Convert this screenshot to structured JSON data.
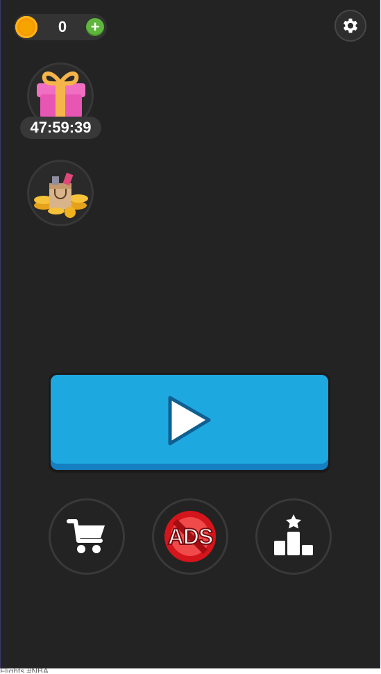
{
  "coins": {
    "count": "0",
    "add_icon": "plus-icon",
    "coin_icon": "coin-icon"
  },
  "settings": {
    "icon": "gear-icon"
  },
  "gift": {
    "icon": "gift-box-icon",
    "timer": "47:59:39"
  },
  "shop_bag": {
    "icon": "shopping-bag-coins-icon"
  },
  "play": {
    "icon": "play-icon",
    "color": "#1ea8e0"
  },
  "bottom_buttons": [
    {
      "icon": "shopping-cart-icon"
    },
    {
      "icon": "no-ads-icon",
      "label": "ADS"
    },
    {
      "icon": "leaderboard-podium-icon"
    }
  ],
  "footer": {
    "text": "Flights #NBA"
  },
  "colors": {
    "background": "#232323",
    "accent_blue": "#1ea8e0",
    "coin_gold": "#f5a400",
    "add_green": "#5fb63c",
    "ads_red": "#d4151b"
  }
}
